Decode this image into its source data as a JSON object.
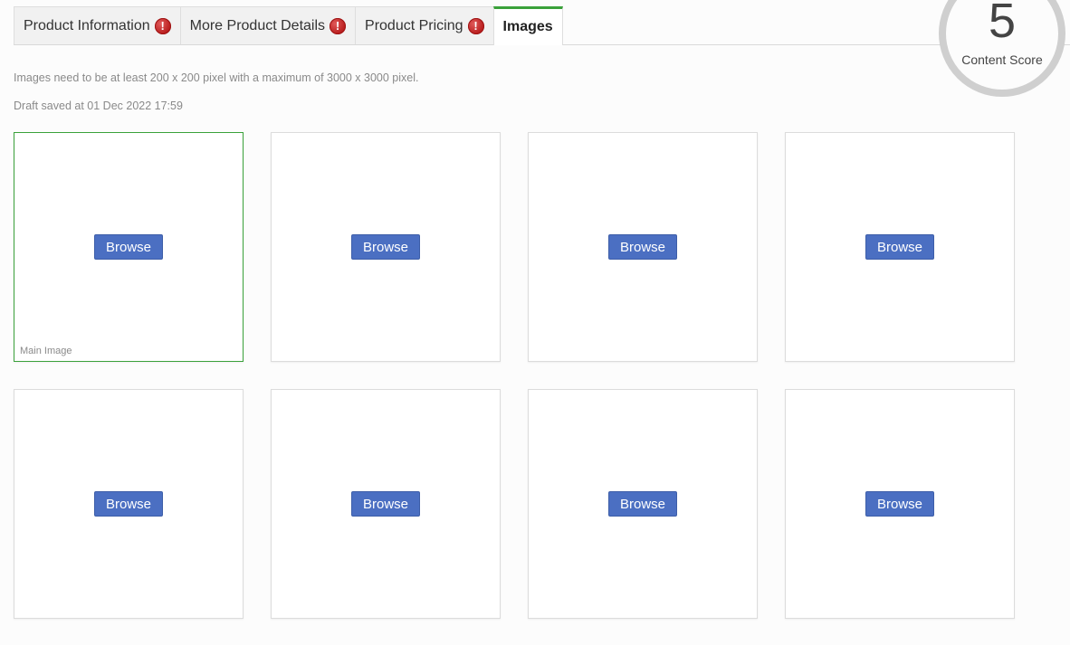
{
  "tabs": [
    {
      "label": "Product Information",
      "warning": true,
      "active": false
    },
    {
      "label": "More Product Details",
      "warning": true,
      "active": false
    },
    {
      "label": "Product Pricing",
      "warning": true,
      "active": false
    },
    {
      "label": "Images",
      "warning": false,
      "active": true
    }
  ],
  "warning_icon_glyph": "!",
  "content_score": {
    "value": "5",
    "label": "Content Score"
  },
  "info_text": "Images need to be at least 200 x 200 pixel with a maximum of 3000 x 3000 pixel.",
  "draft_text": "Draft saved at 01 Dec 2022 17:59",
  "image_slots": [
    {
      "button_label": "Browse",
      "caption": "Main Image"
    },
    {
      "button_label": "Browse",
      "caption": ""
    },
    {
      "button_label": "Browse",
      "caption": ""
    },
    {
      "button_label": "Browse",
      "caption": ""
    },
    {
      "button_label": "Browse",
      "caption": ""
    },
    {
      "button_label": "Browse",
      "caption": ""
    },
    {
      "button_label": "Browse",
      "caption": ""
    },
    {
      "button_label": "Browse",
      "caption": ""
    }
  ],
  "colors": {
    "accent_green": "#3aa13a",
    "button_blue": "#4b6fc2",
    "warning_red": "#c62828"
  }
}
